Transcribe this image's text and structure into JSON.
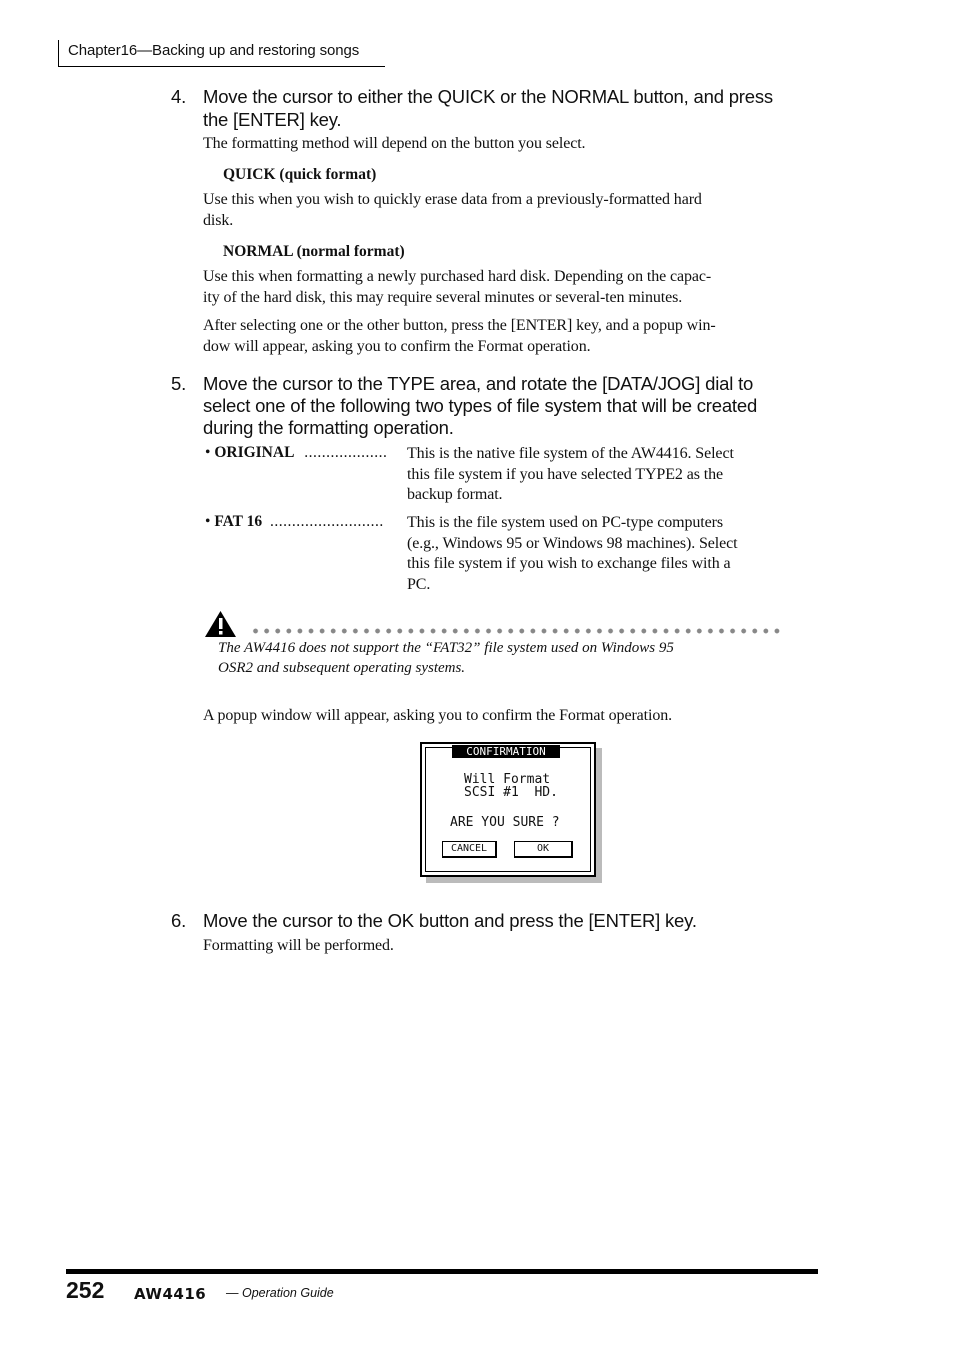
{
  "header": {
    "chapter": "Chapter16—Backing up and restoring songs"
  },
  "steps": [
    {
      "number": "4.",
      "title_line1": "Move the cursor to either the QUICK or the NORMAL button, and press",
      "title_line2": "the [ENTER] key.",
      "desc": "The formatting method will depend on the button you select.",
      "quick": {
        "heading": "QUICK (quick format)",
        "line1": "Use this when you wish to quickly erase data from a previously-formatted hard",
        "line2": "disk."
      },
      "normal": {
        "heading": "NORMAL (normal format)",
        "line1": "Use this when formatting a newly purchased hard disk. Depending on the capac-",
        "line2": "ity of the hard disk, this may require several minutes or several-ten minutes."
      },
      "after_line1": "After selecting one or the other button, press the [ENTER] key, and a popup win-",
      "after_line2": "dow will appear, asking you to confirm the Format operation."
    },
    {
      "number": "5.",
      "title_line1": "Move the cursor to the TYPE area, and rotate the [DATA/JOG] dial to",
      "title_line2": "select one of the following two types of file system that will be created",
      "title_line3": "during the formatting operation.",
      "definitions": [
        {
          "bullet": "•",
          "term": "ORIGINAL",
          "dots": "...................",
          "lines": [
            "This is the native file system of the AW4416. Select",
            "this file system if you have selected TYPE2 as the",
            "backup format."
          ]
        },
        {
          "bullet": "•",
          "term": "FAT 16",
          "dots": "..........................",
          "lines": [
            "This is the file system used on PC-type computers",
            "(e.g., Windows 95 or Windows 98 machines). Select",
            "this file system if you wish to exchange files with a",
            "PC."
          ]
        }
      ],
      "warning": {
        "icon": "warning-triangle-icon",
        "line1": "The AW4416 does not support the “FAT32” file system used on Windows 95",
        "line2": "OSR2 and subsequent operating systems."
      },
      "popup_intro": "A popup window will appear, asking you to confirm the Format operation."
    },
    {
      "number": "6.",
      "title_line1": "Move the cursor to the OK button and press the [ENTER] key.",
      "desc": "Formatting will be performed."
    }
  ],
  "lcd_popup": {
    "title": "CONFIRMATION",
    "line1": "Will Format",
    "line2": "SCSI #1  HD.",
    "question": "ARE YOU SURE ?",
    "cancel_label": "CANCEL",
    "ok_label": "OK"
  },
  "footer": {
    "page_number": "252",
    "logo": "AW4416",
    "guide": "— Operation Guide"
  }
}
